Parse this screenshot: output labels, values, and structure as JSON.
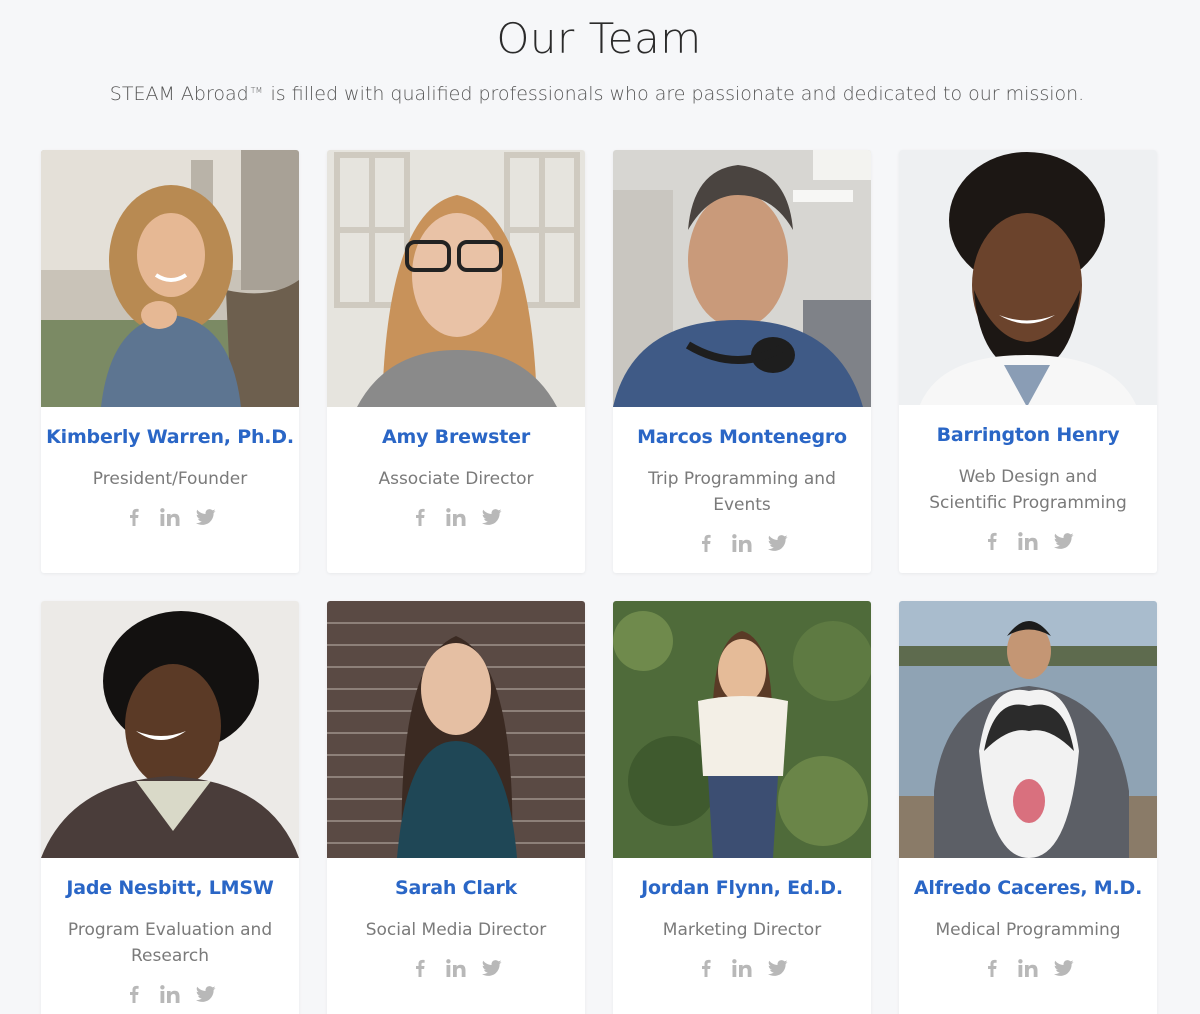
{
  "section": {
    "title": "Our Team",
    "subtitle_brand": "STEAM Abroad",
    "subtitle_tm": "TM",
    "subtitle_rest": "is filled with qualified professionals who are passionate and dedicated to our mission."
  },
  "colors": {
    "name": "#2a66c6",
    "role": "#7a7a7a",
    "icon": "#b8b8b8",
    "background": "#f6f7f9"
  },
  "members": [
    {
      "name": "Kimberly Warren, Ph.D.",
      "role": "President/Founder"
    },
    {
      "name": "Amy Brewster",
      "role": "Associate Director"
    },
    {
      "name": "Marcos Montenegro",
      "role": "Trip Programming and Events"
    },
    {
      "name": "Barrington Henry",
      "role": "Web Design and Scientific Programming"
    },
    {
      "name": "Jade Nesbitt, LMSW",
      "role": "Program Evaluation and Research"
    },
    {
      "name": "Sarah Clark",
      "role": "Social Media Director"
    },
    {
      "name": "Jordan Flynn, Ed.D.",
      "role": "Marketing Director"
    },
    {
      "name": "Alfredo Caceres, M.D.",
      "role": "Medical Programming"
    }
  ],
  "social_icons": [
    "facebook-icon",
    "linkedin-icon",
    "twitter-icon"
  ]
}
